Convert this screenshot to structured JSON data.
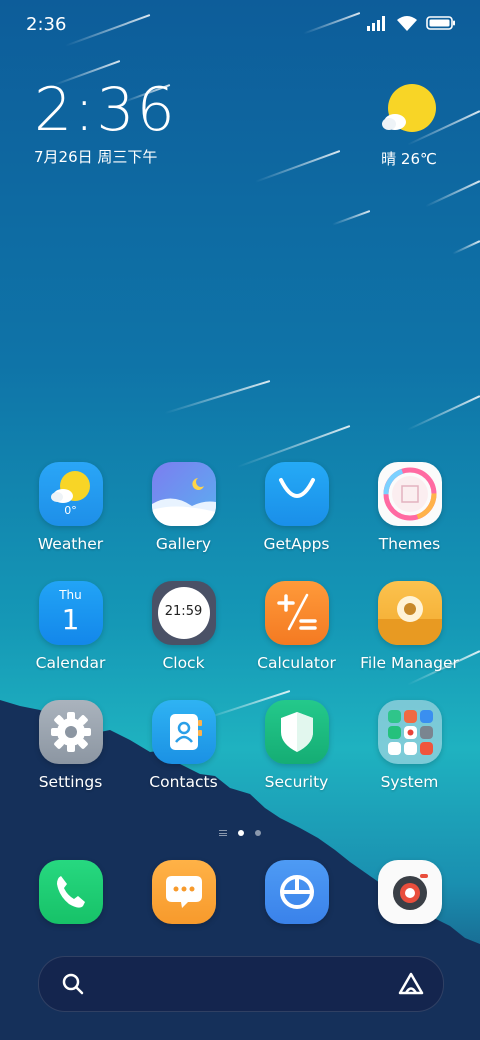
{
  "status_bar": {
    "time": "2:36",
    "icons": [
      "signal-icon",
      "wifi-icon",
      "battery-icon"
    ]
  },
  "clock_widget": {
    "time": "2:36",
    "date": "7月26日 周三下午"
  },
  "weather_widget": {
    "condition": "晴 26℃",
    "icon": "sunny-icon"
  },
  "apps": [
    {
      "label": "Weather",
      "icon": "weather-icon",
      "badge": "0°"
    },
    {
      "label": "Gallery",
      "icon": "gallery-icon"
    },
    {
      "label": "GetApps",
      "icon": "getapps-icon"
    },
    {
      "label": "Themes",
      "icon": "themes-icon"
    },
    {
      "label": "Calendar",
      "icon": "calendar-icon",
      "day_name": "Thu",
      "day_num": "1"
    },
    {
      "label": "Clock",
      "icon": "clock-icon",
      "clock_time": "21:59"
    },
    {
      "label": "Calculator",
      "icon": "calculator-icon"
    },
    {
      "label": "File Manager",
      "icon": "file-manager-icon"
    },
    {
      "label": "Settings",
      "icon": "settings-icon"
    },
    {
      "label": "Contacts",
      "icon": "contacts-icon"
    },
    {
      "label": "Security",
      "icon": "security-icon"
    },
    {
      "label": "System",
      "icon": "system-folder-icon"
    }
  ],
  "pager": {
    "pages": 2,
    "current": 1
  },
  "dock": [
    {
      "icon": "phone-icon"
    },
    {
      "icon": "messages-icon"
    },
    {
      "icon": "browser-icon"
    },
    {
      "icon": "camera-icon"
    }
  ],
  "search_bar": {
    "icons": [
      "search-icon",
      "assistant-icon"
    ]
  },
  "colors": {
    "weather": "#2b9df4",
    "getapps": "#1e9ff2",
    "calendar": "#1592f2",
    "calculator": "#f7862a",
    "file_manager": "#f5b53a",
    "settings": "#9aa4b0",
    "contacts": "#29a3ea",
    "security": "#1ebd80",
    "phone": "#1fce76",
    "messages": "#f8a63b",
    "browser": "#3e8ef0"
  }
}
